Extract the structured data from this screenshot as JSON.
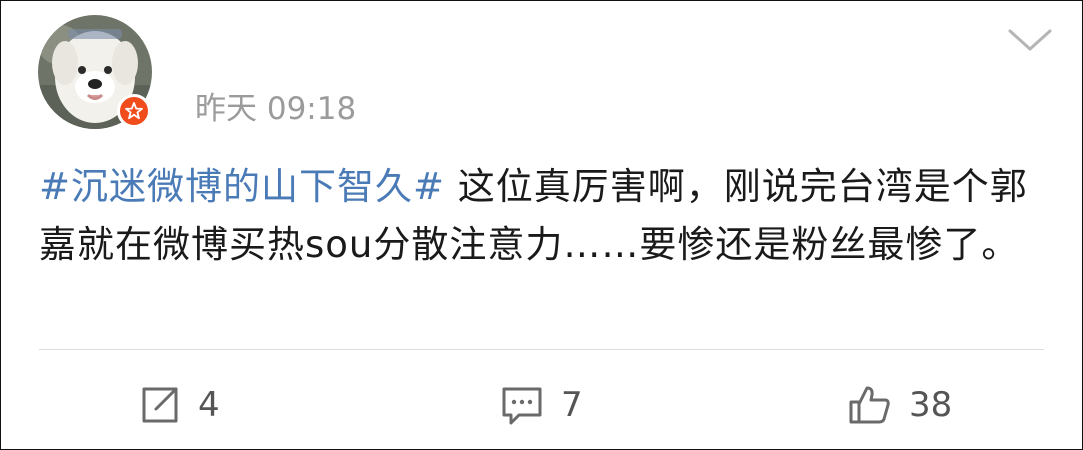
{
  "post": {
    "timestamp": "昨天 09:18",
    "hashtag": "#沉迷微博的山下智久#",
    "body": " 这位真厉害啊，刚说完台湾是个郭嘉就在微博买热sou分散注意力……要惨还是粉丝最惨了。"
  },
  "actions": {
    "repost_count": "4",
    "comment_count": "7",
    "like_count": "38"
  },
  "colors": {
    "hashtag": "#4a7bb7",
    "verified_badge": "#f14c1c",
    "timestamp": "#9b9b9b"
  },
  "icons": {
    "avatar": "dog-avatar",
    "verified": "verified-star-icon",
    "menu": "chevron-down-icon",
    "repost": "repost-icon",
    "comment": "comment-icon",
    "like": "thumbs-up-icon"
  }
}
